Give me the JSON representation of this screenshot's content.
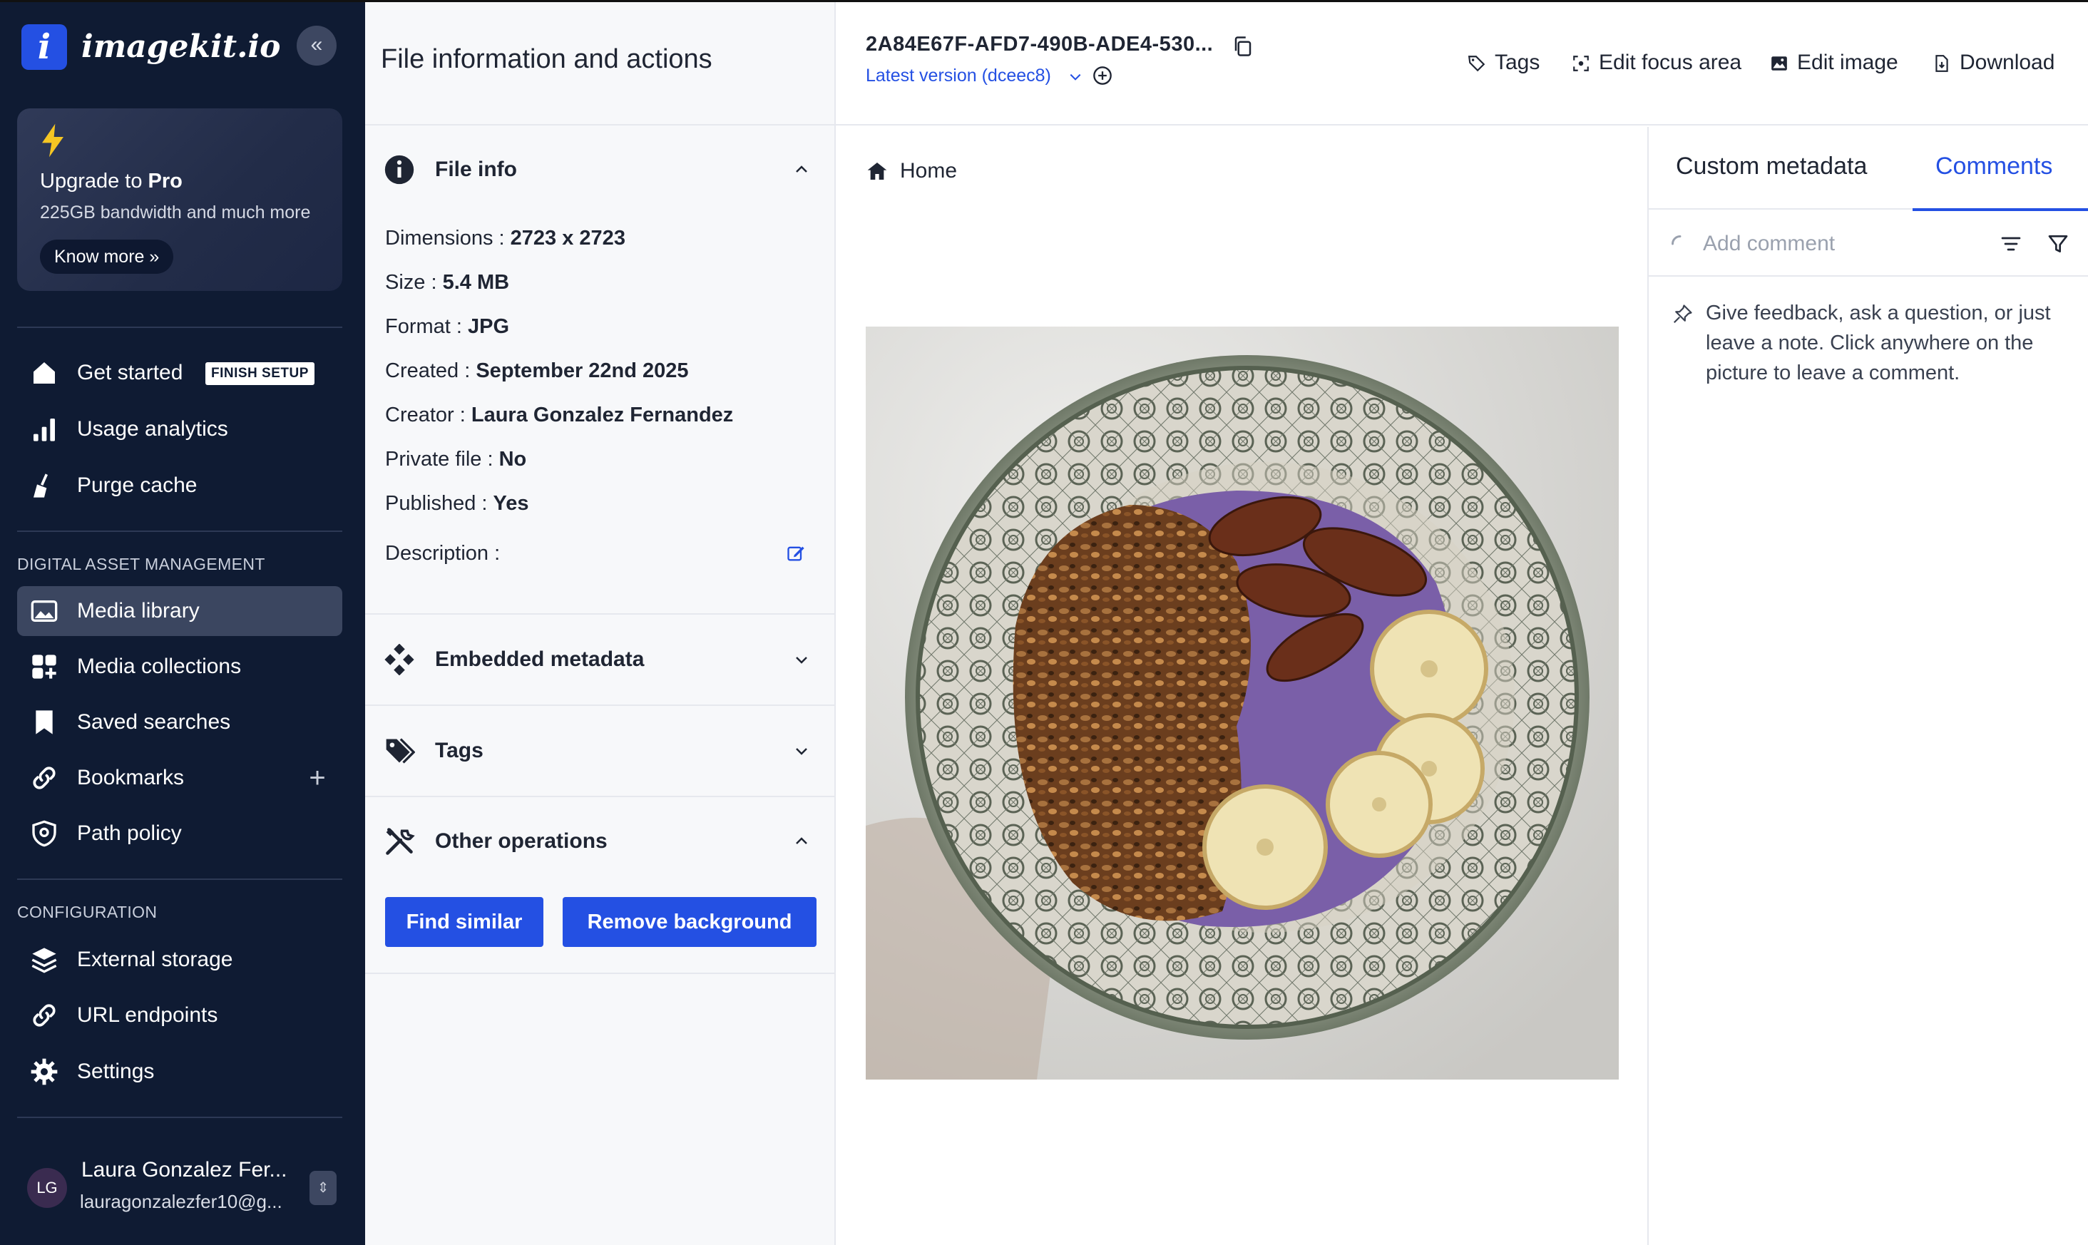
{
  "brand": {
    "logo_letter": "i",
    "name": "imagekit.io",
    "collapse_glyph": "«"
  },
  "upgrade": {
    "title_prefix": "Upgrade to ",
    "title_bold": "Pro",
    "subtitle": "225GB bandwidth and much more",
    "button": "Know more »"
  },
  "nav": {
    "get_started": "Get started",
    "finish_badge": "FINISH SETUP",
    "usage_analytics": "Usage analytics",
    "purge_cache": "Purge cache",
    "dam_section": "DIGITAL ASSET MANAGEMENT",
    "media_library": "Media library",
    "media_collections": "Media collections",
    "saved_searches": "Saved searches",
    "bookmarks": "Bookmarks",
    "bookmarks_add": "+",
    "path_policy": "Path policy",
    "config_section": "CONFIGURATION",
    "external_storage": "External storage",
    "url_endpoints": "URL endpoints",
    "settings": "Settings"
  },
  "user": {
    "initials": "LG",
    "name": "Laura Gonzalez Fer...",
    "email": "lauragonzalezfer10@g...",
    "switch_glyph": "⇕"
  },
  "info_panel": {
    "title": "File information and actions",
    "file_info_label": "File info",
    "properties": [
      {
        "label": "Dimensions : ",
        "value": "2723 x 2723"
      },
      {
        "label": "Size : ",
        "value": "5.4 MB"
      },
      {
        "label": "Format : ",
        "value": "JPG"
      },
      {
        "label": "Created : ",
        "value": "September 22nd 2025"
      },
      {
        "label": "Creator : ",
        "value": "Laura Gonzalez Fernandez"
      },
      {
        "label": "Private file : ",
        "value": "No"
      },
      {
        "label": "Published : ",
        "value": "Yes"
      },
      {
        "label": "Description :",
        "value": ""
      }
    ],
    "embedded_metadata_label": "Embedded metadata",
    "tags_label": "Tags",
    "other_operations_label": "Other operations",
    "find_similar": "Find similar",
    "remove_background": "Remove background"
  },
  "main": {
    "file_id": "2A84E67F-AFD7-490B-ADE4-530...",
    "version": "Latest version (dceec8)",
    "actions": {
      "tags": "Tags",
      "edit_focus": "Edit focus area",
      "edit_image": "Edit image",
      "download": "Download"
    },
    "breadcrumb_home": "Home"
  },
  "right_panel": {
    "tab_custom_metadata": "Custom metadata",
    "tab_comments": "Comments",
    "add_comment_placeholder": "Add comment",
    "hint": "Give feedback, ask a question, or just leave a note. Click anywhere on the picture to leave a comment."
  },
  "colors": {
    "sidebar_bg": "#0f1b33",
    "accent": "#2450e3",
    "active_nav_bg": "#3b4660",
    "panel_bg": "#f7f8fa"
  }
}
